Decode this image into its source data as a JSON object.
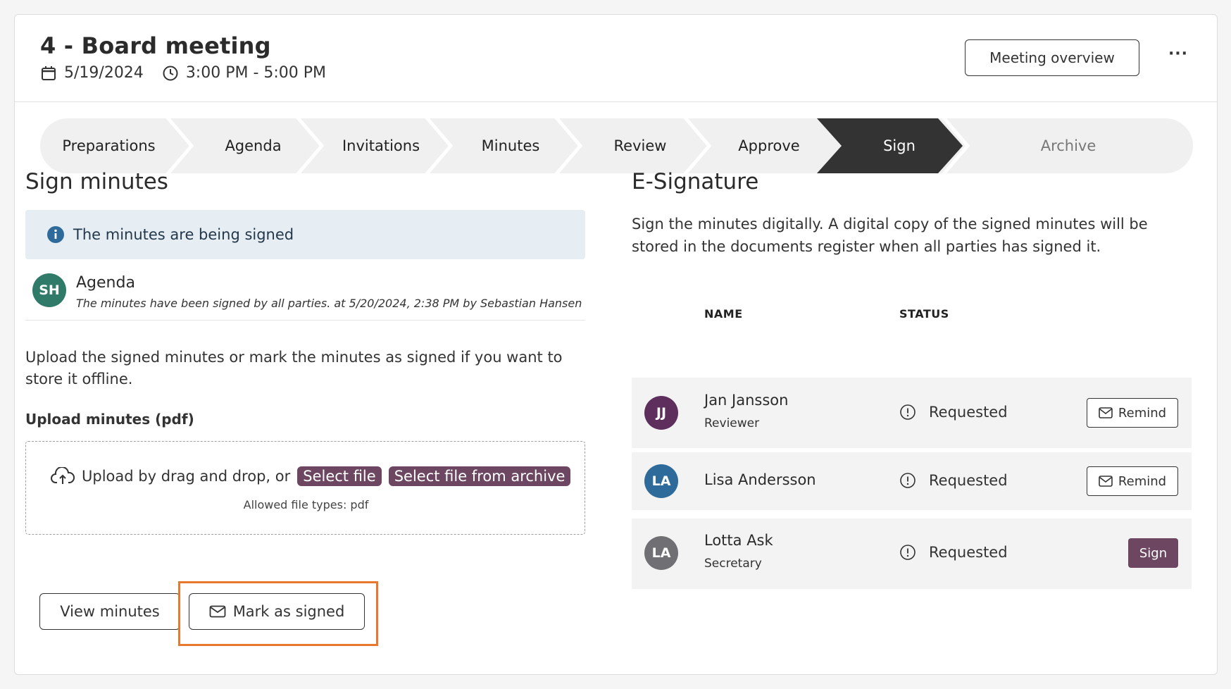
{
  "header": {
    "title": "4 - Board meeting",
    "date": "5/19/2024",
    "time": "3:00 PM - 5:00 PM",
    "overview_button": "Meeting overview",
    "more_button": "···"
  },
  "stepper": {
    "steps": [
      "Preparations",
      "Agenda",
      "Invitations",
      "Minutes",
      "Review",
      "Approve",
      "Sign",
      "Archive"
    ],
    "active": "Sign"
  },
  "sign_minutes": {
    "heading": "Sign minutes",
    "info": "The minutes are being signed",
    "signed": {
      "initials": "SH",
      "title": "Agenda",
      "subtitle": "The minutes have been signed by all parties. at 5/20/2024, 2:38 PM by Sebastian Hansen"
    },
    "description": "Upload the signed minutes or mark the minutes as signed if you want to store it offline.",
    "upload_label": "Upload minutes (pdf)",
    "dropzone": {
      "text": "Upload by drag and drop, or",
      "select_file": "Select file",
      "select_archive": "Select file from archive",
      "allowed": "Allowed file types: pdf"
    },
    "view_button": "View minutes",
    "mark_button": "Mark as signed"
  },
  "esignature": {
    "heading": "E-Signature",
    "description": "Sign the minutes digitally. A digital copy of the signed minutes will be stored in the documents register when all parties has signed it.",
    "columns": [
      "NAME",
      "STATUS"
    ],
    "rows": [
      {
        "initials": "JJ",
        "name": "Jan Jansson",
        "role": "Reviewer",
        "status": "Requested",
        "action": "Remind",
        "color": "#5e2f5d"
      },
      {
        "initials": "LA",
        "name": "Lisa Andersson",
        "role": "",
        "status": "Requested",
        "action": "Remind",
        "color": "#2f6b9a"
      },
      {
        "initials": "LA",
        "name": "Lotta Ask",
        "role": "Secretary",
        "status": "Requested",
        "action": "Sign",
        "color": "#6f6f74"
      }
    ]
  },
  "colors": {
    "accent": "#6d4762",
    "active_step": "#333333",
    "highlight": "#e9782f",
    "sh_avatar": "#2f7a68"
  }
}
